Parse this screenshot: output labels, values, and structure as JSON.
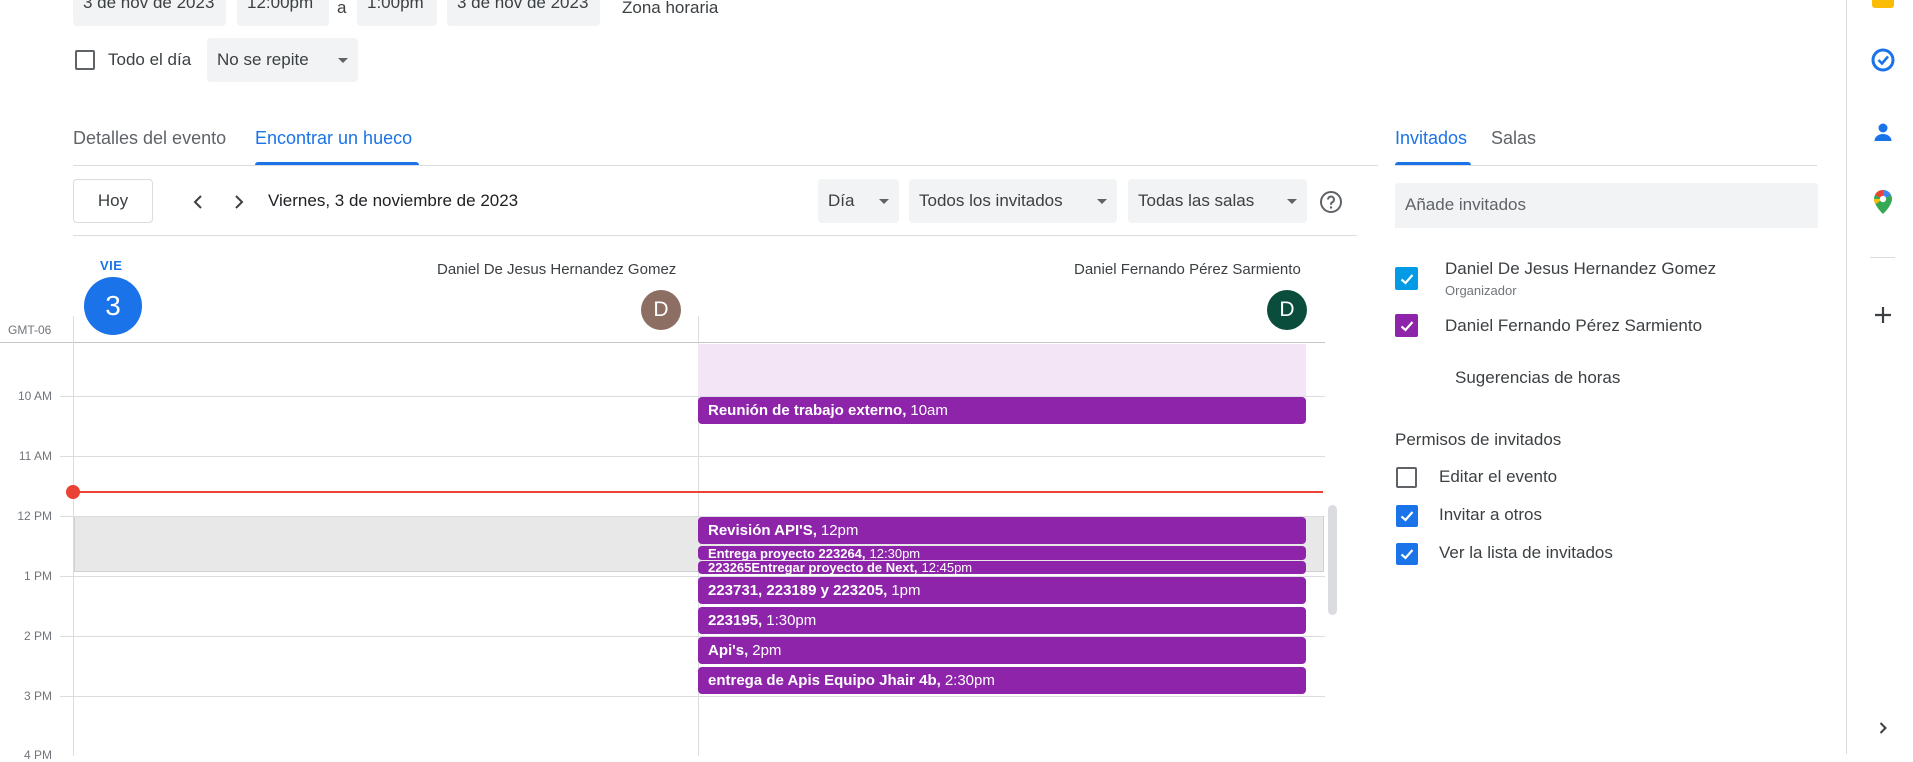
{
  "top_row": {
    "start_date": "3 de nov de 2023",
    "start_time": "12:00pm",
    "separator": "a",
    "end_time": "1:00pm",
    "end_date": "3 de nov de 2023",
    "timezone": "Zona horaria"
  },
  "options_row": {
    "all_day_label": "Todo el día",
    "repeat_value": "No se repite"
  },
  "tabs": [
    {
      "label": "Detalles del evento",
      "active": false
    },
    {
      "label": "Encontrar un hueco",
      "active": true
    }
  ],
  "toolbar": {
    "today": "Hoy",
    "date_title": "Viernes, 3 de noviembre de 2023",
    "view_select": "Día",
    "guests_select": "Todos los invitados",
    "rooms_select": "Todas las salas"
  },
  "day_header": {
    "weekday": "VIE",
    "day_number": "3",
    "timezone": "GMT-06"
  },
  "people": [
    {
      "name": "Daniel De Jesus Hernandez Gomez",
      "initial": "D",
      "color": "#8d6e63"
    },
    {
      "name": "Daniel Fernando Pérez Sarmiento",
      "initial": "D",
      "color": "#0b4d3c"
    }
  ],
  "hours": [
    "10 AM",
    "11 AM",
    "12 PM",
    "1 PM",
    "2 PM",
    "3 PM",
    "4 PM"
  ],
  "events": [
    {
      "title": "Reunión de trabajo externo,",
      "time": "10am"
    },
    {
      "title": "Revisión API'S,",
      "time": "12pm"
    },
    {
      "title": "Entrega proyecto 223264,",
      "time": "12:30pm"
    },
    {
      "title": "223265Entregar proyecto de Next,",
      "time": "12:45pm"
    },
    {
      "title": "223731, 223189 y 223205,",
      "time": "1pm"
    },
    {
      "title": "223195,",
      "time": "1:30pm"
    },
    {
      "title": "Api's,",
      "time": "2pm"
    },
    {
      "title": "entrega de Apis Equipo Jhair 4b,",
      "time": "2:30pm"
    }
  ],
  "right_panel": {
    "tabs": [
      {
        "label": "Invitados",
        "active": true
      },
      {
        "label": "Salas",
        "active": false
      }
    ],
    "add_guests_placeholder": "Añade invitados",
    "guests": [
      {
        "name": "Daniel De Jesus Hernandez Gomez",
        "role": "Organizador",
        "color": "#039be5"
      },
      {
        "name": "Daniel Fernando Pérez Sarmiento",
        "role": "",
        "color": "#8e24aa"
      }
    ],
    "suggestions": "Sugerencias de horas",
    "permissions_title": "Permisos de invitados",
    "permissions": [
      {
        "label": "Editar el evento",
        "checked": false
      },
      {
        "label": "Invitar a otros",
        "checked": true
      },
      {
        "label": "Ver la lista de invitados",
        "checked": true
      }
    ]
  },
  "colors": {
    "accent": "#1a73e8",
    "event": "#8e24aa",
    "current_time": "#ea4335"
  }
}
